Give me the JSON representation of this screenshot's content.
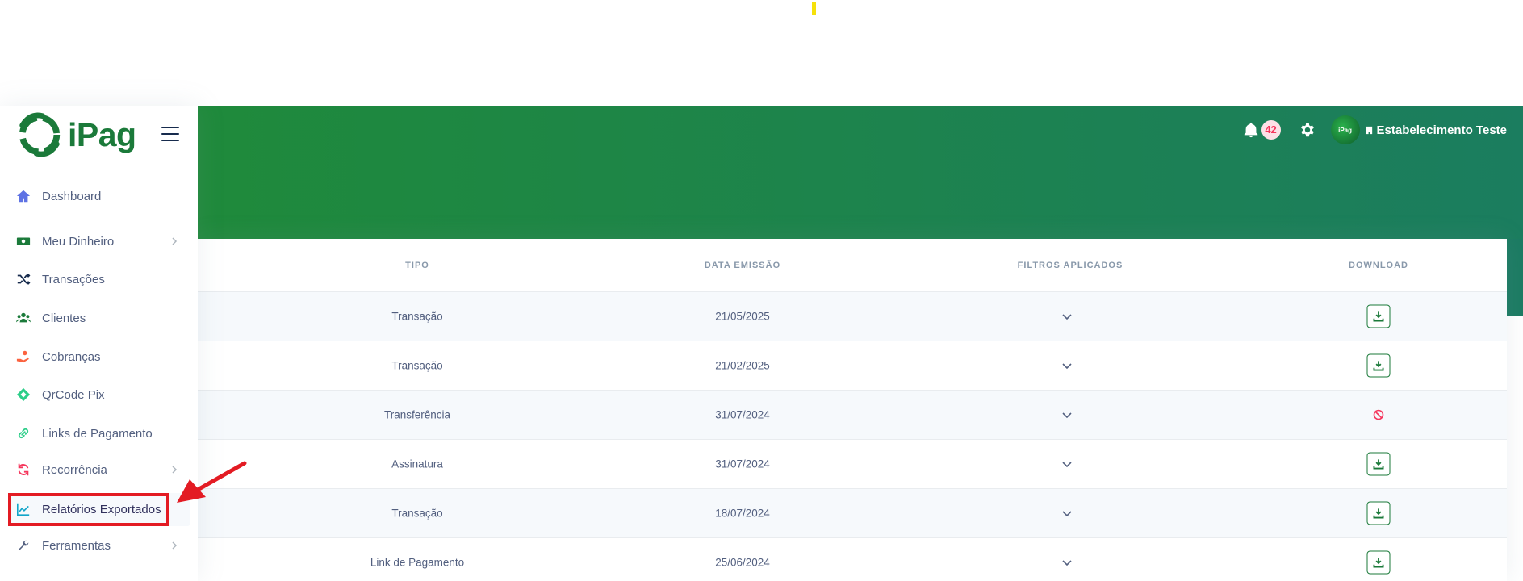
{
  "brand": {
    "name": "iPag"
  },
  "sidebar": {
    "items": [
      {
        "label": "Dashboard",
        "icon": "home-icon",
        "color": "#5e72e4",
        "chevron": false
      },
      {
        "label": "Meu Dinheiro",
        "icon": "money-icon",
        "color": "#1b7a3a",
        "chevron": true
      },
      {
        "label": "Transações",
        "icon": "shuffle-icon",
        "color": "#172b4d",
        "chevron": false
      },
      {
        "label": "Clientes",
        "icon": "users-icon",
        "color": "#1b7a3a",
        "chevron": false
      },
      {
        "label": "Cobranças",
        "icon": "hand-coin-icon",
        "color": "#fb6340",
        "chevron": false
      },
      {
        "label": "QrCode Pix",
        "icon": "pix-icon",
        "color": "#2dce89",
        "chevron": false
      },
      {
        "label": "Links de Pagamento",
        "icon": "link-icon",
        "color": "#2dce89",
        "chevron": false
      },
      {
        "label": "Recorrência",
        "icon": "refresh-icon",
        "color": "#f5365c",
        "chevron": true
      },
      {
        "label": "Relatórios Exportados",
        "icon": "chart-line-icon",
        "color": "#11cdef",
        "chevron": false
      },
      {
        "label": "Ferramentas",
        "icon": "wrench-icon",
        "color": "#525f7f",
        "chevron": true
      }
    ]
  },
  "topbar": {
    "notification_count": "42",
    "user_name": "Estabelecimento Teste",
    "avatar_text": "iPag"
  },
  "table": {
    "columns": [
      "Tipo",
      "Data Emissão",
      "Filtros Aplicados",
      "Download"
    ],
    "rows": [
      {
        "tipo": "Transação",
        "data": "21/05/2025",
        "download": "available"
      },
      {
        "tipo": "Transação",
        "data": "21/02/2025",
        "download": "available"
      },
      {
        "tipo": "Transferência",
        "data": "31/07/2024",
        "download": "blocked"
      },
      {
        "tipo": "Assinatura",
        "data": "31/07/2024",
        "download": "available"
      },
      {
        "tipo": "Transação",
        "data": "18/07/2024",
        "download": "available"
      },
      {
        "tipo": "Link de Pagamento",
        "data": "25/06/2024",
        "download": "available"
      }
    ]
  },
  "colors": {
    "brand_green": "#1b7a3a",
    "header_start": "#1f8a3b",
    "header_end": "#1b7d5f",
    "highlight_red": "#e31b23"
  }
}
